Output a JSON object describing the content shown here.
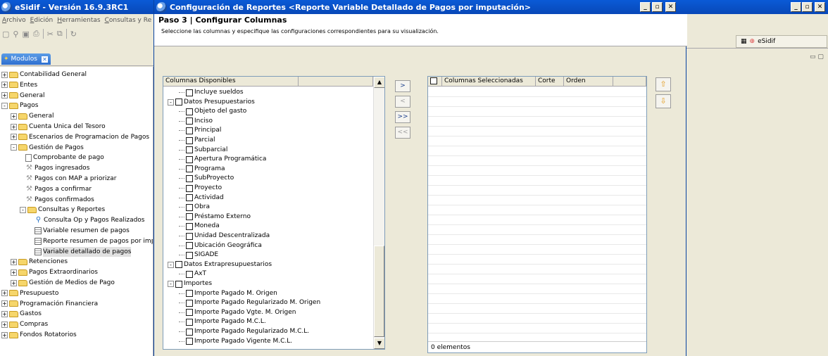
{
  "main_window": {
    "title": "eSidif - Versión 16.9.3RC1",
    "menu": [
      "Archivo",
      "Edición",
      "Herramientas",
      "Consultas y Re"
    ],
    "toolbar_icons": [
      "new-doc-icon",
      "search-icon",
      "save-icon",
      "print-icon",
      "cut-icon",
      "copy-icon",
      "paste-icon"
    ],
    "modules_tab": "Modulos"
  },
  "tree": [
    {
      "label": "Contabilidad General",
      "level": 0,
      "exp": "+",
      "icon": "folder"
    },
    {
      "label": "Entes",
      "level": 0,
      "exp": "+",
      "icon": "folder"
    },
    {
      "label": "General",
      "level": 0,
      "exp": "+",
      "icon": "folder"
    },
    {
      "label": "Pagos",
      "level": 0,
      "exp": "-",
      "icon": "folder"
    },
    {
      "label": "General",
      "level": 1,
      "exp": "+",
      "icon": "folder"
    },
    {
      "label": "Cuenta Unica del Tesoro",
      "level": 1,
      "exp": "+",
      "icon": "folder"
    },
    {
      "label": "Escenarios de Programacion de Pagos",
      "level": 1,
      "exp": "+",
      "icon": "folder"
    },
    {
      "label": "Gestión de Pagos",
      "level": 1,
      "exp": "-",
      "icon": "folder"
    },
    {
      "label": "Comprobante de pago",
      "level": 2,
      "exp": "",
      "icon": "doc"
    },
    {
      "label": "Pagos ingresados",
      "level": 2,
      "exp": "",
      "icon": "wrench"
    },
    {
      "label": "Pagos con MAP a priorizar",
      "level": 2,
      "exp": "",
      "icon": "wrench"
    },
    {
      "label": "Pagos a confirmar",
      "level": 2,
      "exp": "",
      "icon": "wrench"
    },
    {
      "label": "Pagos confirmados",
      "level": 2,
      "exp": "",
      "icon": "wrench"
    },
    {
      "label": "Consultas y Reportes",
      "level": 2,
      "exp": "-",
      "icon": "folder"
    },
    {
      "label": "Consulta Op y Pagos Realizados",
      "level": 3,
      "exp": "",
      "icon": "search"
    },
    {
      "label": "Variable resumen de pagos",
      "level": 3,
      "exp": "",
      "icon": "grid"
    },
    {
      "label": "Reporte resumen de pagos por imputación",
      "level": 3,
      "exp": "",
      "icon": "grid"
    },
    {
      "label": "Variable detallado de pagos",
      "level": 3,
      "exp": "",
      "icon": "grid",
      "selected": true
    },
    {
      "label": "Retenciones",
      "level": 1,
      "exp": "+",
      "icon": "folder"
    },
    {
      "label": "Pagos Extraordinarios",
      "level": 1,
      "exp": "+",
      "icon": "folder"
    },
    {
      "label": "Gestión de Medios de Pago",
      "level": 1,
      "exp": "+",
      "icon": "folder"
    },
    {
      "label": "Presupuesto",
      "level": 0,
      "exp": "+",
      "icon": "folder"
    },
    {
      "label": "Programación Financiera",
      "level": 0,
      "exp": "+",
      "icon": "folder"
    },
    {
      "label": "Gastos",
      "level": 0,
      "exp": "+",
      "icon": "folder"
    },
    {
      "label": "Compras",
      "level": 0,
      "exp": "+",
      "icon": "folder"
    },
    {
      "label": "Fondos Rotatorios",
      "level": 0,
      "exp": "+",
      "icon": "folder"
    }
  ],
  "dialog": {
    "title": "Configuración de Reportes <Reporte Variable Detallado de Pagos por imputación>",
    "step_title": "Paso 3 | Configurar Columnas",
    "step_desc": "Seleccione las columnas y especifique las configuraciones correspondientes para su visualización.",
    "available_header": "Columnas Disponibles",
    "available": [
      {
        "label": "Incluye sueldos",
        "level": 1,
        "exp": ""
      },
      {
        "label": "Datos Presupuestarios",
        "level": 0,
        "exp": "-"
      },
      {
        "label": "Objeto del gasto",
        "level": 1,
        "exp": ""
      },
      {
        "label": "Inciso",
        "level": 1,
        "exp": ""
      },
      {
        "label": "Principal",
        "level": 1,
        "exp": ""
      },
      {
        "label": "Parcial",
        "level": 1,
        "exp": ""
      },
      {
        "label": "Subparcial",
        "level": 1,
        "exp": ""
      },
      {
        "label": "Apertura Programática",
        "level": 1,
        "exp": ""
      },
      {
        "label": "Programa",
        "level": 1,
        "exp": ""
      },
      {
        "label": "SubProyecto",
        "level": 1,
        "exp": ""
      },
      {
        "label": "Proyecto",
        "level": 1,
        "exp": ""
      },
      {
        "label": "Actividad",
        "level": 1,
        "exp": ""
      },
      {
        "label": "Obra",
        "level": 1,
        "exp": ""
      },
      {
        "label": "Préstamo Externo",
        "level": 1,
        "exp": ""
      },
      {
        "label": "Moneda",
        "level": 1,
        "exp": ""
      },
      {
        "label": "Unidad Descentralizada",
        "level": 1,
        "exp": ""
      },
      {
        "label": "Ubicación Geográfica",
        "level": 1,
        "exp": ""
      },
      {
        "label": "SIGADE",
        "level": 1,
        "exp": ""
      },
      {
        "label": "Datos Extrapresupuestarios",
        "level": 0,
        "exp": "-"
      },
      {
        "label": "AxT",
        "level": 1,
        "exp": ""
      },
      {
        "label": "Importes",
        "level": 0,
        "exp": "-"
      },
      {
        "label": "Importe Pagado M. Origen",
        "level": 1,
        "exp": ""
      },
      {
        "label": "Importe Pagado Regularizado M. Origen",
        "level": 1,
        "exp": ""
      },
      {
        "label": "Importe Pagado Vgte. M. Origen",
        "level": 1,
        "exp": ""
      },
      {
        "label": "Importe Pagado M.C.L.",
        "level": 1,
        "exp": ""
      },
      {
        "label": "Importe Pagado Regularizado M.C.L.",
        "level": 1,
        "exp": ""
      },
      {
        "label": "Importe Pagado Vigente M.C.L.",
        "level": 1,
        "exp": ""
      }
    ],
    "move_buttons": [
      ">",
      "<",
      ">>",
      "<<"
    ],
    "selected_headers": [
      "Columnas Seleccionadas",
      "Corte",
      "Orden"
    ],
    "footer": "0 elementos"
  },
  "right": {
    "tab_label": "eSidif"
  }
}
